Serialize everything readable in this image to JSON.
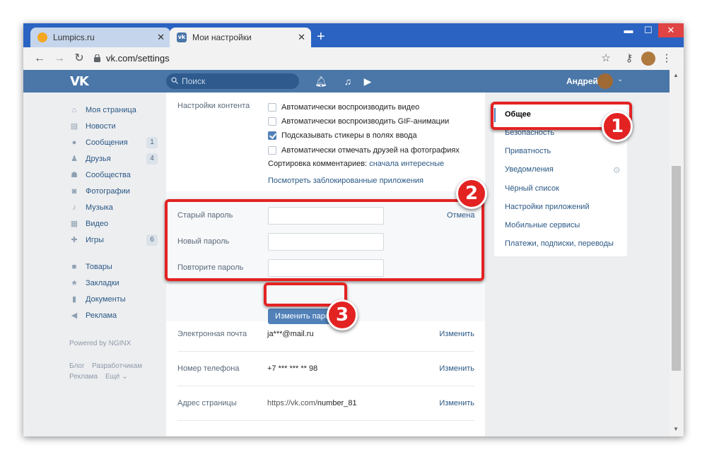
{
  "browser": {
    "tabs": [
      {
        "title": "Lumpics.ru",
        "close": "✕"
      },
      {
        "title": "Мои настройки",
        "close": "✕"
      }
    ],
    "new_tab": "+",
    "url": "vk.com/settings",
    "window_controls": {
      "minimize": "▬",
      "maximize": "☐",
      "close": "✕"
    }
  },
  "vk_header": {
    "logo": "VK",
    "search_placeholder": "Поиск",
    "user_name": "Андрей"
  },
  "left_menu": {
    "items": [
      {
        "label": "Моя страница",
        "icon": "home-icon",
        "badge": ""
      },
      {
        "label": "Новости",
        "icon": "news-icon",
        "badge": ""
      },
      {
        "label": "Сообщения",
        "icon": "messages-icon",
        "badge": "1"
      },
      {
        "label": "Друзья",
        "icon": "friends-icon",
        "badge": "4"
      },
      {
        "label": "Сообщества",
        "icon": "communities-icon",
        "badge": ""
      },
      {
        "label": "Фотографии",
        "icon": "camera-icon",
        "badge": ""
      },
      {
        "label": "Музыка",
        "icon": "music-icon",
        "badge": ""
      },
      {
        "label": "Видео",
        "icon": "video-icon",
        "badge": ""
      },
      {
        "label": "Игры",
        "icon": "gamepad-icon",
        "badge": "6"
      }
    ],
    "extra_items": [
      {
        "label": "Товары",
        "icon": "bag-icon"
      },
      {
        "label": "Закладки",
        "icon": "star-icon"
      },
      {
        "label": "Документы",
        "icon": "document-icon"
      },
      {
        "label": "Реклама",
        "icon": "megaphone-icon"
      }
    ],
    "powered_by": "Powered by NGINX",
    "footer_links": [
      "Блог",
      "Разработчикам",
      "Реклама",
      "Ещё ⌄"
    ]
  },
  "content_settings": {
    "label": "Настройки контента",
    "checkboxes": [
      {
        "label": "Автоматически воспроизводить видео",
        "checked": false
      },
      {
        "label": "Автоматически воспроизводить GIF-анимации",
        "checked": false
      },
      {
        "label": "Подсказывать стикеры в полях ввода",
        "checked": true
      },
      {
        "label": "Автоматически отмечать друзей на фотографиях",
        "checked": false
      }
    ],
    "sort_label": "Сортировка комментариев:",
    "sort_value": "сначала интересные",
    "blocked_apps_link": "Посмотреть заблокированные приложения"
  },
  "password": {
    "old_label": "Старый пароль",
    "new_label": "Новый пароль",
    "repeat_label": "Повторите пароль",
    "old_value": "",
    "new_value": "",
    "repeat_value": "",
    "cancel_link": "Отмена",
    "submit_button": "Изменить пароль"
  },
  "account_rows": [
    {
      "label": "Электронная почта",
      "value": "ja***@mail.ru",
      "action": "Изменить"
    },
    {
      "label": "Номер телефона",
      "value": "+7 *** *** ** 98",
      "action": "Изменить"
    },
    {
      "label": "Адрес страницы",
      "value": "https://vk.com/",
      "value_bold": "number_81",
      "action": "Изменить"
    }
  ],
  "right_menu": {
    "items": [
      "Общее",
      "Безопасность",
      "Приватность",
      "Уведомления",
      "Чёрный список",
      "Настройки приложений",
      "Мобильные сервисы",
      "Платежи, подписки, переводы"
    ],
    "active_index": 0
  },
  "annotations": {
    "steps": [
      "1",
      "2",
      "3"
    ],
    "highlight_color": "#e32222"
  },
  "colors": {
    "vk_blue": "#4a76a8",
    "link": "#2a5885",
    "button": "#5181b8",
    "chrome_frame": "#2a63c2"
  }
}
